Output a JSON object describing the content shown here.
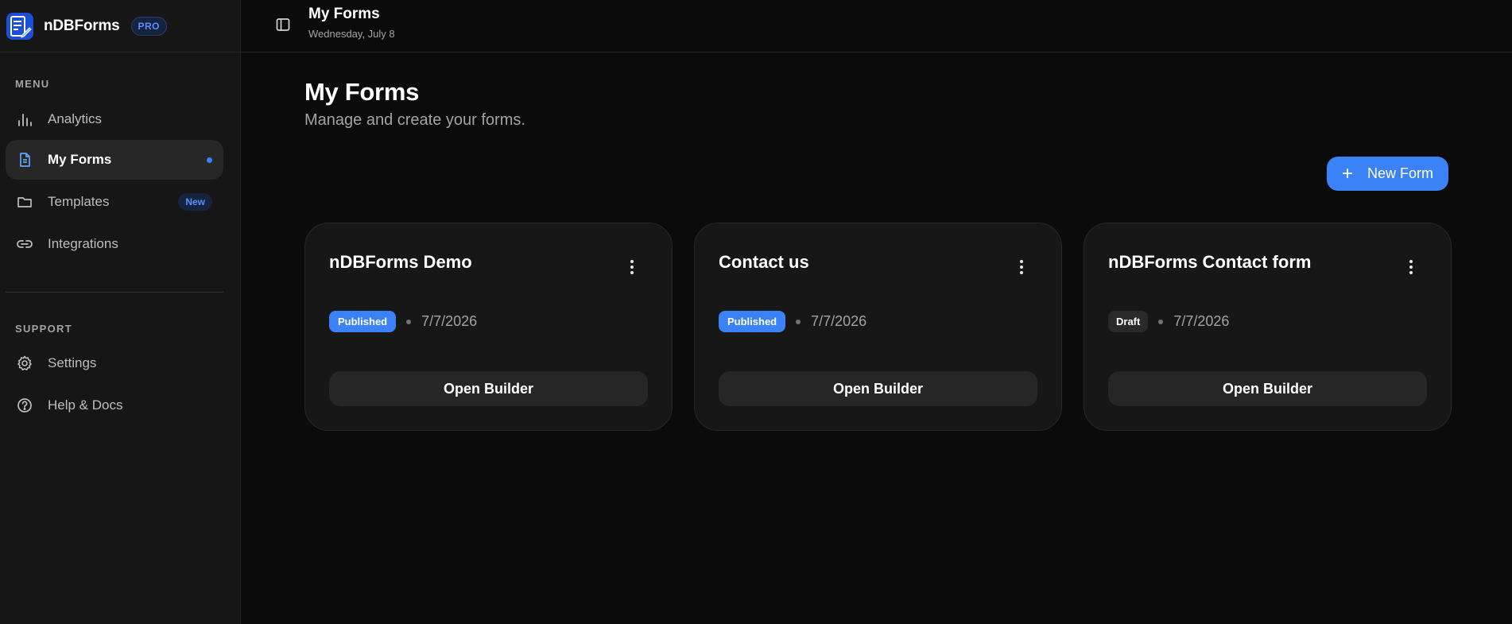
{
  "brand": {
    "name": "nDBForms",
    "badge": "PRO"
  },
  "sidebar": {
    "menu_label": "MENU",
    "menu_items": [
      {
        "label": "Analytics",
        "icon": "bar-chart-icon",
        "active": false
      },
      {
        "label": "My Forms",
        "icon": "document-icon",
        "active": true
      },
      {
        "label": "Templates",
        "icon": "folder-icon",
        "badge": "New"
      },
      {
        "label": "Integrations",
        "icon": "link-icon"
      }
    ],
    "support_label": "SUPPORT",
    "support_items": [
      {
        "label": "Settings",
        "icon": "gear-icon"
      },
      {
        "label": "Help & Docs",
        "icon": "help-circle-icon"
      }
    ]
  },
  "topbar": {
    "title": "My Forms",
    "date": "Wednesday, July 8"
  },
  "page": {
    "title": "My Forms",
    "subtitle": "Manage and create your forms.",
    "new_form_label": "New Form"
  },
  "forms": [
    {
      "title": "nDBForms Demo",
      "status": "Published",
      "date": "7/7/2026",
      "action": "Open Builder"
    },
    {
      "title": "Contact us",
      "status": "Published",
      "date": "7/7/2026",
      "action": "Open Builder"
    },
    {
      "title": "nDBForms Contact form",
      "status": "Draft",
      "date": "7/7/2026",
      "action": "Open Builder"
    }
  ],
  "colors": {
    "accent": "#3b82f6",
    "background": "#0b0b0b",
    "sidebar": "#161616",
    "card": "#171717"
  }
}
